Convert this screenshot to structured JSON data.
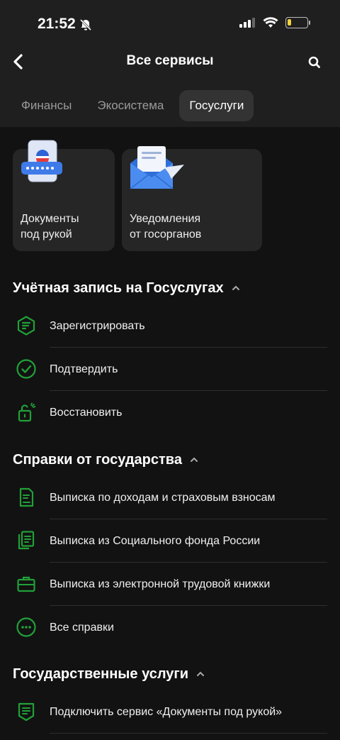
{
  "status": {
    "time": "21:52",
    "battery_level": 0.18
  },
  "header": {
    "title": "Все сервисы"
  },
  "tabs": [
    {
      "label": "Финансы",
      "active": false
    },
    {
      "label": "Экосистема",
      "active": false
    },
    {
      "label": "Госуслуги",
      "active": true
    }
  ],
  "cards": [
    {
      "label": "Документы\nпод рукой",
      "icon": "passport-card-icon"
    },
    {
      "label": "Уведомления\nот госорганов",
      "icon": "envelope-plane-icon"
    }
  ],
  "sections": [
    {
      "title": "Учётная запись на Госуслугах",
      "items": [
        {
          "label": "Зарегистрировать",
          "icon": "register-icon"
        },
        {
          "label": "Подтвердить",
          "icon": "check-circle-icon"
        },
        {
          "label": "Восстановить",
          "icon": "lock-open-icon"
        }
      ]
    },
    {
      "title": "Справки от государства",
      "items": [
        {
          "label": "Выписка по доходам и страховым взносам",
          "icon": "document-icon"
        },
        {
          "label": "Выписка из Социального фонда России",
          "icon": "documents-stack-icon"
        },
        {
          "label": "Выписка из электронной трудовой книжки",
          "icon": "briefcase-icon"
        },
        {
          "label": "Все справки",
          "icon": "more-circle-icon"
        }
      ]
    },
    {
      "title": "Государственные услуги",
      "items": [
        {
          "label": "Подключить сервис «Документы под рукой»",
          "icon": "badge-document-icon"
        }
      ]
    }
  ],
  "colors": {
    "accent": "#21a038",
    "background": "#121212",
    "top_bar": "#1f1f1f",
    "card": "#262626"
  }
}
